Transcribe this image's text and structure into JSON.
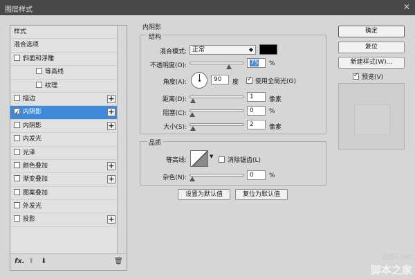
{
  "window": {
    "title": "图层样式",
    "close_glyph": "✕"
  },
  "styles_list": [
    {
      "label": "样式",
      "has_checkbox": false,
      "checked": false,
      "indent": 1,
      "plus": false,
      "active": false
    },
    {
      "label": "混合选项",
      "has_checkbox": false,
      "checked": false,
      "indent": 1,
      "plus": false,
      "active": false
    },
    {
      "label": "斜面和浮雕",
      "has_checkbox": true,
      "checked": false,
      "indent": 1,
      "plus": false,
      "active": false
    },
    {
      "label": "等高线",
      "has_checkbox": true,
      "checked": false,
      "indent": 2,
      "plus": false,
      "active": false
    },
    {
      "label": "纹理",
      "has_checkbox": true,
      "checked": false,
      "indent": 2,
      "plus": false,
      "active": false
    },
    {
      "label": "描边",
      "has_checkbox": true,
      "checked": false,
      "indent": 1,
      "plus": true,
      "active": false
    },
    {
      "label": "内阴影",
      "has_checkbox": true,
      "checked": true,
      "indent": 1,
      "plus": true,
      "active": true
    },
    {
      "label": "内阴影",
      "has_checkbox": true,
      "checked": false,
      "indent": 1,
      "plus": true,
      "active": false
    },
    {
      "label": "内发光",
      "has_checkbox": true,
      "checked": false,
      "indent": 1,
      "plus": false,
      "active": false
    },
    {
      "label": "光泽",
      "has_checkbox": true,
      "checked": false,
      "indent": 1,
      "plus": false,
      "active": false
    },
    {
      "label": "颜色叠加",
      "has_checkbox": true,
      "checked": false,
      "indent": 1,
      "plus": true,
      "active": false
    },
    {
      "label": "渐变叠加",
      "has_checkbox": true,
      "checked": false,
      "indent": 1,
      "plus": true,
      "active": false
    },
    {
      "label": "图案叠加",
      "has_checkbox": true,
      "checked": false,
      "indent": 1,
      "plus": false,
      "active": false
    },
    {
      "label": "外发光",
      "has_checkbox": true,
      "checked": false,
      "indent": 1,
      "plus": false,
      "active": false
    },
    {
      "label": "投影",
      "has_checkbox": true,
      "checked": false,
      "indent": 1,
      "plus": true,
      "active": false
    }
  ],
  "left_toolbar": {
    "fx_label": "fx.",
    "up_icon": "arrow-up-icon",
    "down_icon": "arrow-down-icon",
    "trash_icon": "trash-icon"
  },
  "inner_shadow": {
    "section_title": "内阴影",
    "structure_title": "结构",
    "blend_mode_label": "混合模式:",
    "blend_mode_value": "正常",
    "shadow_color": "#000000",
    "opacity_label": "不透明度(O):",
    "opacity_value": "75",
    "opacity_unit": "%",
    "opacity_level": 0.75,
    "angle_label": "角度(A):",
    "angle_value": "90",
    "angle_unit": "度",
    "global_light_label": "使用全局光(G)",
    "global_light_checked": true,
    "distance_label": "距离(D):",
    "distance_value": "1",
    "distance_unit": "像素",
    "distance_level": 0.01,
    "choke_label": "阻塞(C):",
    "choke_value": "0",
    "choke_unit": "%",
    "choke_level": 0,
    "size_label": "大小(S):",
    "size_value": "2",
    "size_unit": "像素",
    "size_level": 0.01,
    "quality_title": "品质",
    "contour_label": "等高线:",
    "antialias_label": "消除锯齿(L)",
    "antialias_checked": false,
    "noise_label": "杂色(N):",
    "noise_value": "0",
    "noise_unit": "%",
    "noise_level": 0,
    "set_default_label": "设置为默认值",
    "reset_default_label": "复位为默认值"
  },
  "right_buttons": {
    "ok_label": "确定",
    "reset_label": "复位",
    "new_style_label": "新建样式(W)...",
    "preview_label": "预览(V)",
    "preview_checked": true
  },
  "watermark": {
    "url": "jb51.net",
    "name": "脚本之家"
  },
  "colors": {
    "accent": "#3f8ad8",
    "dialog_bg": "#d6d6d6",
    "titlebar": "#484848"
  }
}
